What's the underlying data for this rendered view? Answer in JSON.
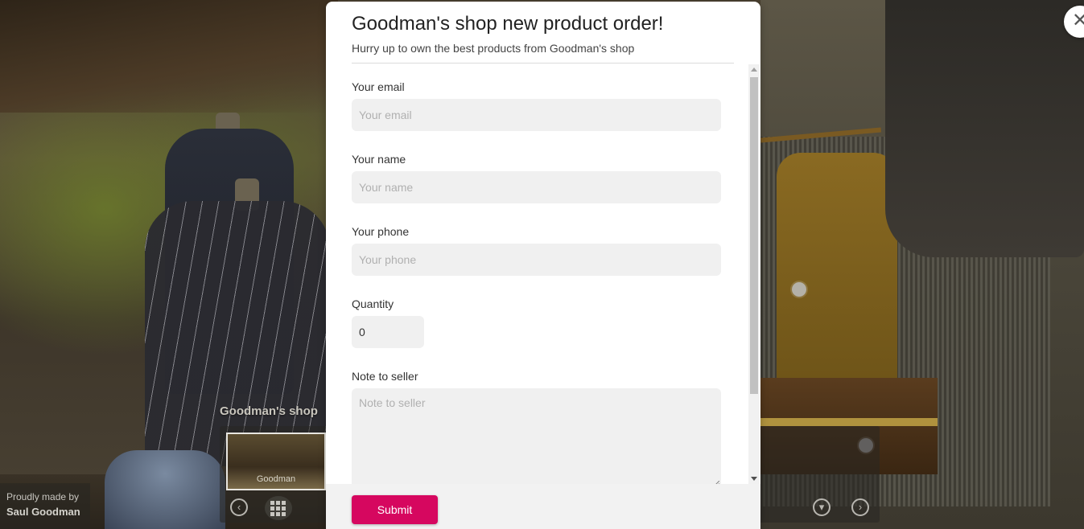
{
  "modal": {
    "title": "Goodman's shop new product order!",
    "subtitle": "Hurry up to own the best products from Goodman's shop",
    "fields": {
      "email": {
        "label": "Your email",
        "placeholder": "Your email",
        "value": ""
      },
      "name": {
        "label": "Your name",
        "placeholder": "Your name",
        "value": ""
      },
      "phone": {
        "label": "Your phone",
        "placeholder": "Your phone",
        "value": ""
      },
      "quantity": {
        "label": "Quantity",
        "value": "0"
      },
      "note": {
        "label": "Note to seller",
        "placeholder": "Note to seller",
        "value": ""
      }
    },
    "submit_label": "Submit"
  },
  "tour": {
    "title": "Goodman's shop",
    "thumbnail_label": "Goodman",
    "credit_line1": "Proudly made by",
    "credit_line2": "Saul Goodman"
  },
  "icons": {
    "close": "close-icon",
    "prev": "chevron-left-icon",
    "grid": "grid-icon",
    "down": "chevron-down-icon",
    "next": "chevron-right-icon"
  },
  "colors": {
    "submit_button": "#d6075f",
    "input_background": "#f0f0f0"
  }
}
